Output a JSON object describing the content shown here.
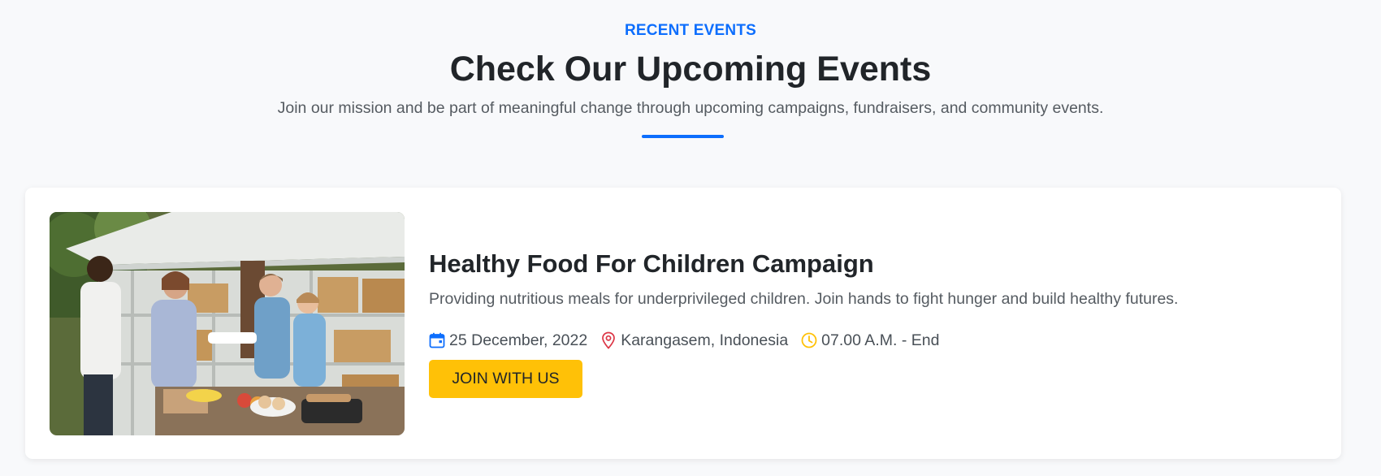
{
  "section": {
    "eyebrow": "RECENT EVENTS",
    "title": "Check Our Upcoming Events",
    "subtitle": "Join our mission and be part of meaningful change through upcoming campaigns, fundraisers, and community events."
  },
  "event": {
    "title": "Healthy Food For Children Campaign",
    "description": "Providing nutritious meals for underprivileged children. Join hands to fight hunger and build healthy futures.",
    "date": "25 December, 2022",
    "location": "Karangasem, Indonesia",
    "time": "07.00 A.M. - End",
    "button_label": "JOIN WITH US",
    "image": "volunteers-serving-food-photo"
  },
  "icons": {
    "date": "calendar-icon",
    "location": "map-pin-icon",
    "time": "clock-icon"
  },
  "colors": {
    "accent": "#0d6efd",
    "button": "#ffc107",
    "pin": "#dc3545",
    "clock": "#ffc107",
    "background": "#f8f9fb"
  }
}
